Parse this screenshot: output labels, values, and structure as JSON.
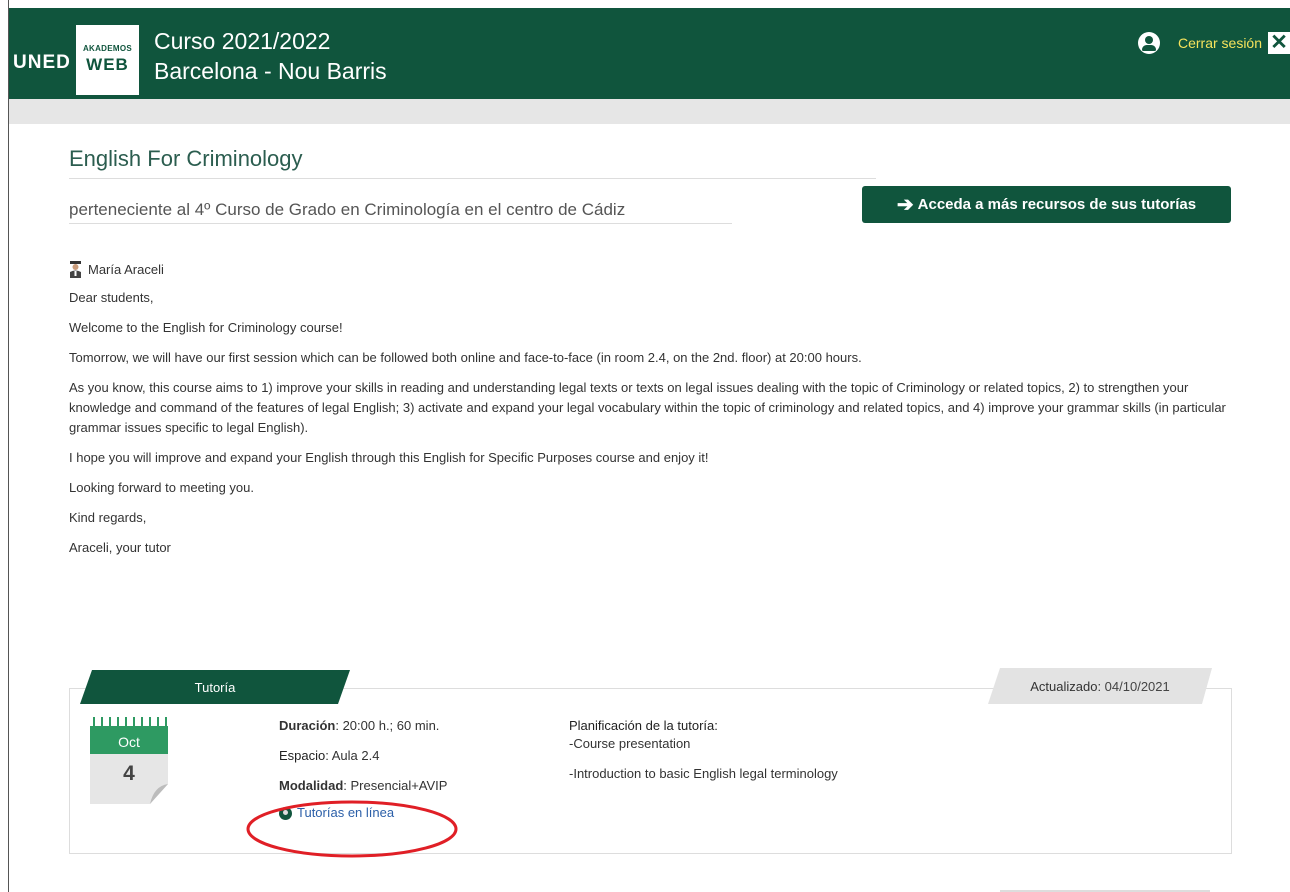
{
  "header": {
    "logo_text": "UNED",
    "logo_small": "AKADEMOS",
    "logo_web": "WEB",
    "course_year": "Curso 2021/2022",
    "center": "Barcelona - Nou Barris",
    "logout_label": "Cerrar sesión",
    "close_glyph": "✕"
  },
  "course": {
    "title": "English For Criminology",
    "subtitle": "perteneciente al 4º Curso de Grado en Criminología en el centro de Cádiz",
    "resources_button": "Acceda a más recursos de sus tutorías",
    "tutor_name": "María Araceli"
  },
  "message": [
    "Dear students,",
    "Welcome to the English for Criminology course!",
    "Tomorrow, we will have our first session which can be followed both online and face-to-face (in room 2.4, on the 2nd. floor) at 20:00 hours.",
    "As you know, this course aims to 1) improve your skills in reading and understanding legal texts or texts on legal issues dealing with the topic of Criminology or related topics, 2) to strengthen your knowledge and command of the features of legal English; 3) activate and expand your legal vocabulary within the topic of criminology and related topics, and 4) improve your grammar skills (in particular grammar issues specific to legal English).",
    "I hope you will improve and expand your English through this English for Specific Purposes course and enjoy it!",
    "Looking forward to meeting you.",
    "Kind regards,",
    "Araceli, your tutor"
  ],
  "tutoria": {
    "tab_label": "Tutoría",
    "updated_label": "Actualizado",
    "updated_date": ": 04/10/2021",
    "calendar_month": "Oct",
    "calendar_day": "4",
    "duration_label": "Duración",
    "duration_value": ": 20:00 h.; 60 min.",
    "space_label": "Espacio",
    "space_value": ": Aula 2.4",
    "mode_label": "Modalidad",
    "mode_value": ": Presencial+AVIP",
    "online_link": "Tutorías en línea",
    "plan_heading": "Planificación de la tutoría:",
    "plan_items": [
      "-Course presentation",
      "-Introduction to basic English legal terminology"
    ]
  },
  "colors": {
    "brand_green": "#10553d",
    "logout_yellow": "#f5e35c",
    "annotation_red": "#e01f26",
    "link_blue": "#2b5fa8"
  }
}
